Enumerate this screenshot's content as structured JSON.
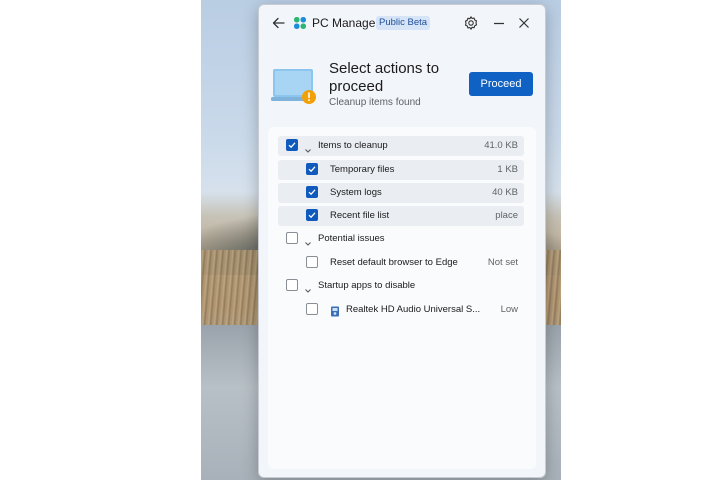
{
  "app": {
    "title": "PC Manager",
    "badge": "Public Beta",
    "icons": [
      "back-arrow-icon",
      "pc-manager-logo-icon",
      "gear-icon",
      "minimize-icon",
      "close-icon"
    ],
    "colors": {
      "accent": "#0f62c4",
      "checkbox": "#1059bd",
      "badge_bg": "#d6e4f7",
      "warning": "#f2a007"
    }
  },
  "hero": {
    "title": "Select actions to proceed",
    "subtitle": "Cleanup items found",
    "proceed_label": "Proceed"
  },
  "groups": [
    {
      "label": "Items to cleanup",
      "value": "41.0 KB",
      "checked": true,
      "expanded": true,
      "items": [
        {
          "label": "Temporary files",
          "value": "1 KB",
          "checked": true
        },
        {
          "label": "System logs",
          "value": "40 KB",
          "checked": true
        },
        {
          "label": "Recent file list",
          "value": "place",
          "checked": true
        }
      ]
    },
    {
      "label": "Potential issues",
      "value": "",
      "checked": false,
      "expanded": true,
      "items": [
        {
          "label": "Reset default browser to Edge",
          "value": "Not set",
          "checked": false
        }
      ]
    },
    {
      "label": "Startup apps to disable",
      "value": "",
      "checked": false,
      "expanded": true,
      "items": [
        {
          "label": "Realtek HD Audio Universal S...",
          "value": "Low",
          "checked": false,
          "icon": "realtek-app-icon"
        }
      ]
    }
  ]
}
